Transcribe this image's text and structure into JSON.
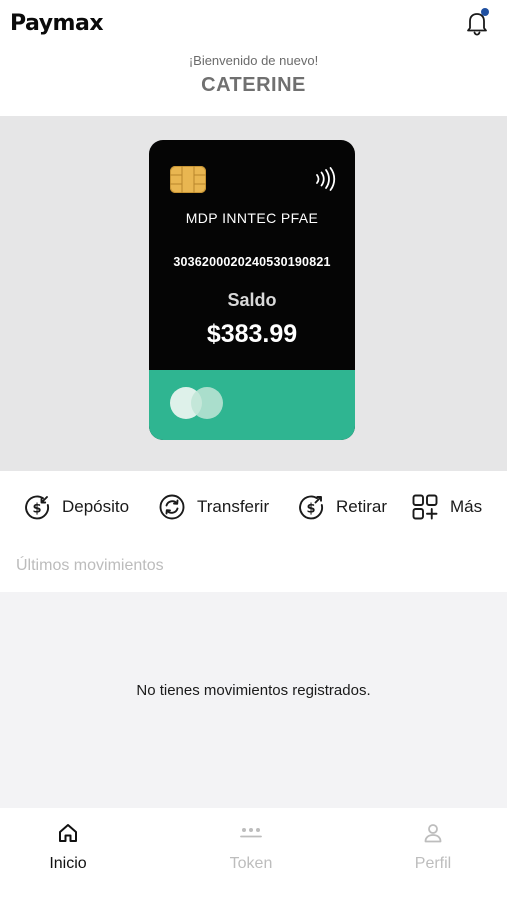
{
  "app": {
    "logo_text": "Paymax"
  },
  "header": {
    "welcome": "¡Bienvenido de nuevo!",
    "username": "CATERINE",
    "notification_icon": "bell-icon",
    "notification_dot_color": "#1f4fa0"
  },
  "card": {
    "name": "MDP INNTEC PFAE",
    "number": "3036200020240530190821",
    "balance_label": "Saldo",
    "balance": "$383.99",
    "background_color": "#050505",
    "accent_color": "#2fb591",
    "chip_icon": "chip-icon",
    "contactless_icon": "contactless-icon",
    "brand_icon": "card-brand-circles-icon"
  },
  "actions": [
    {
      "label": "Depósito",
      "icon": "deposit-icon"
    },
    {
      "label": "Transferir",
      "icon": "transfer-icon"
    },
    {
      "label": "Retirar",
      "icon": "withdraw-icon"
    },
    {
      "label": "Más",
      "icon": "grid-plus-icon"
    }
  ],
  "movements": {
    "title": "Últimos movimientos",
    "empty_message": "No tienes movimientos registrados."
  },
  "bottom_nav": {
    "items": [
      {
        "label": "Inicio",
        "icon": "home-icon",
        "active": true
      },
      {
        "label": "Token",
        "icon": "token-dots-icon",
        "active": false
      },
      {
        "label": "Perfil",
        "icon": "user-icon",
        "active": false
      }
    ],
    "active_color": "#111111",
    "inactive_color": "#bdbdbd"
  }
}
